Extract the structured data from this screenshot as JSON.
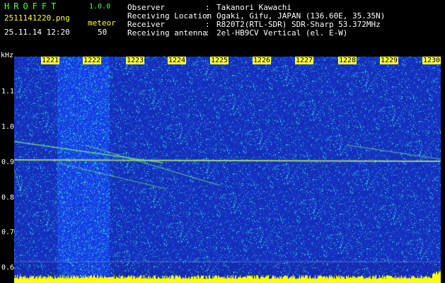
{
  "header": {
    "title": "HROFFT",
    "version": "1.0.0",
    "filename": "2511141220.png",
    "datetime": "25.11.14 12:20",
    "type_label": "meteor",
    "count": "50",
    "info": [
      {
        "key": "Observer",
        "value": "Takanori Kawachi"
      },
      {
        "key": "Receiving Location",
        "value": "Ogaki, Gifu, JAPAN (136.60E, 35.35N)"
      },
      {
        "key": "Receiver",
        "value": "R820T2(RTL-SDR) SDR-Sharp 53.372MHz"
      },
      {
        "key": "Receiving antenna",
        "value": "2el-HB9CV Vertical (el. E-W)"
      }
    ],
    "separator": ":"
  },
  "axis": {
    "unit": "kHz",
    "y_ticks": [
      "1.1",
      "1.0",
      "0.9",
      "0.8",
      "0.7",
      "0.6"
    ],
    "x_ticks": [
      "1221",
      "1222",
      "1223",
      "1224",
      "1225",
      "1226",
      "1227",
      "1228",
      "1229",
      "1230"
    ]
  },
  "colors": {
    "background": "#000000",
    "header_green": "#4cff4c",
    "header_yellow": "#ffff3a",
    "header_white": "#ffffff",
    "spectrum_blue": "#1a2ec8",
    "signal_line": "#ffe066",
    "noise_floor": "#ffff00"
  }
}
